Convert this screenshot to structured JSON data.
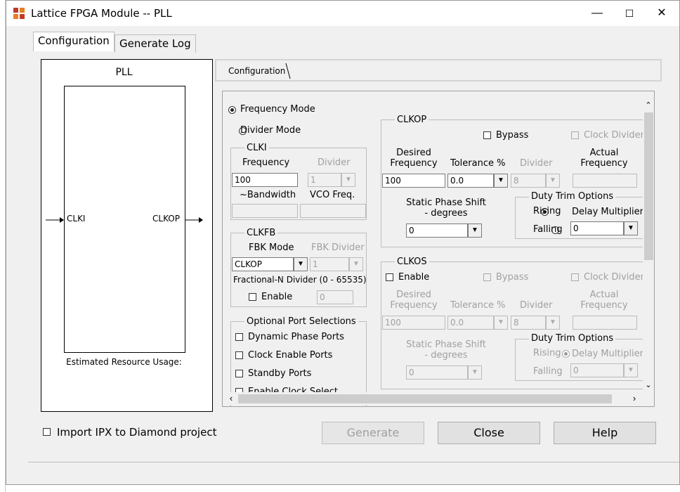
{
  "window": {
    "title": "Lattice FPGA Module -- PLL",
    "minimize": "—",
    "maximize": "☐",
    "close": "✕"
  },
  "tabs": {
    "configuration": "Configuration",
    "generate_log": "Generate Log"
  },
  "diagram": {
    "title": "PLL",
    "input_port": "CLKI",
    "output_port": "CLKOP",
    "resource_label": "Estimated Resource Usage:"
  },
  "inner_tab": "Configuration",
  "mode": {
    "frequency": "Frequency Mode",
    "divider": "Divider Mode"
  },
  "clki": {
    "group": "CLKI",
    "frequency_label": "Frequency",
    "divider_label": "Divider",
    "frequency_value": "100",
    "divider_value": "1",
    "bandwidth_label": "~Bandwidth",
    "vco_label": "VCO Freq."
  },
  "clkfb": {
    "group": "CLKFB",
    "fbk_mode_label": "FBK Mode",
    "fbk_divider_label": "FBK Divider",
    "fbk_mode_value": "CLKOP",
    "fbk_divider_value": "1",
    "fractional_label": "Fractional-N Divider (0 - 65535)",
    "enable_label": "Enable",
    "fractional_value": "0"
  },
  "optional": {
    "group": "Optional Port Selections",
    "items": [
      "Dynamic Phase Ports",
      "Clock Enable Ports",
      "Standby Ports",
      "Enable Clock Select"
    ]
  },
  "clkop": {
    "group": "CLKOP",
    "bypass": "Bypass",
    "clock_divider": "Clock Divider",
    "desired_freq": "Desired\nFrequency",
    "tolerance": "Tolerance %",
    "divider": "Divider",
    "actual_freq": "Actual\nFrequency",
    "desired_value": "100",
    "tolerance_value": "0.0",
    "divider_value": "8",
    "phase_label": "Static Phase Shift\n- degrees",
    "phase_value": "0",
    "duty_group": "Duty Trim Options",
    "rising": "Rising",
    "falling": "Falling",
    "delay_mult": "Delay Multiplier",
    "delay_value": "0"
  },
  "clkos": {
    "group": "CLKOS",
    "enable": "Enable",
    "bypass": "Bypass",
    "clock_divider": "Clock Divider",
    "desired_freq": "Desired\nFrequency",
    "tolerance": "Tolerance %",
    "divider": "Divider",
    "actual_freq": "Actual\nFrequency",
    "desired_value": "100",
    "tolerance_value": "0.0",
    "divider_value": "8",
    "phase_label": "Static Phase Shift\n- degrees",
    "phase_value": "0",
    "duty_group": "Duty Trim Options",
    "rising": "Rising",
    "falling": "Falling",
    "delay_mult": "Delay Multiplier",
    "delay_value": "0"
  },
  "footer": {
    "import_ipx": "Import IPX to Diamond project",
    "generate": "Generate",
    "close": "Close",
    "help": "Help"
  }
}
